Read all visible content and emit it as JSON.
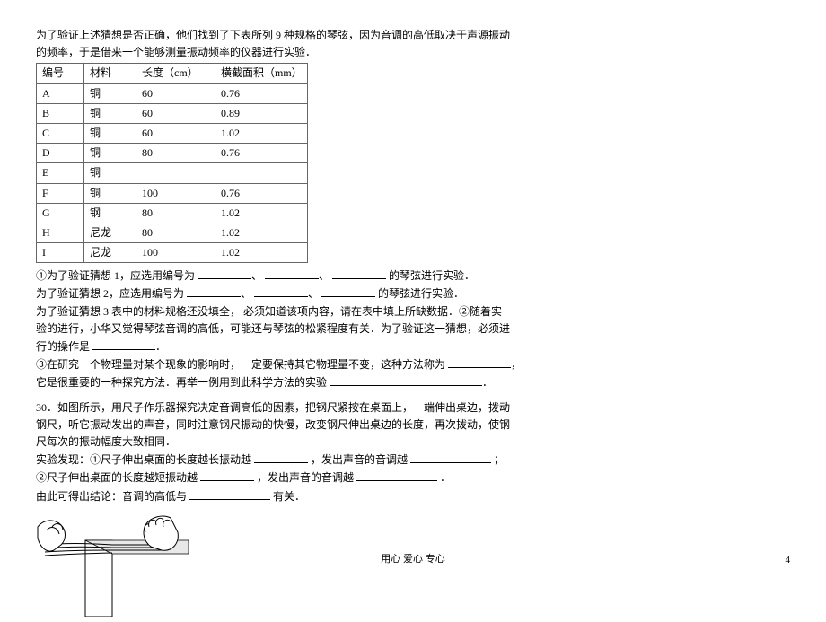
{
  "intro_line1": "为了验证上述猜想是否正确，他们找到了下表所列 9 种规格的琴弦，因为音调的高低取决于声源振动",
  "intro_line2": "的频率，于是借来一个能够测量振动频率的仪器进行实验．",
  "table": {
    "headers": [
      "编号",
      "材料",
      "长度（cm）",
      "横截面积（mm）"
    ],
    "rows": [
      [
        "A",
        "铜",
        "60",
        "0.76"
      ],
      [
        "B",
        "铜",
        "60",
        "0.89"
      ],
      [
        "C",
        "铜",
        "60",
        "1.02"
      ],
      [
        "D",
        "铜",
        "80",
        "0.76"
      ],
      [
        "E",
        "铜",
        "",
        ""
      ],
      [
        "F",
        "铜",
        "100",
        "0.76"
      ],
      [
        "G",
        "钢",
        "80",
        "1.02"
      ],
      [
        "H",
        "尼龙",
        "80",
        "1.02"
      ],
      [
        "I",
        "尼龙",
        "100",
        "1.02"
      ]
    ]
  },
  "q1_a": "①为了验证猜想 1，应选用编号为",
  "q1_b": "的琴弦进行实验．",
  "q2_a": "为了验证猜想 2，应选用编号为",
  "q2_b": "的琴弦进行实验．",
  "q3_a": "为了验证猜想 3  表中的材料规格还没填全，  必须知道该项内容，请在表中填上所缺数据．②随着实",
  "q3_b": "验的进行，小华又觉得琴弦音调的高低，可能还与琴弦的松紧程度有关．为了验证这一猜想，必须进",
  "q3_c": "行的操作是",
  "q4_a": "③在研究一个物理量对某个现象的影响时，一定要保持其它物理量不变，这种方法称为",
  "q4_b": "它是很重要的一种探究方法．再举一例用到此科学方法的实验",
  "q30_a": "30．如图所示，用尺子作乐器探究决定音调高低的因素，把钢尺紧按在桌面上，一端伸出桌边，拨动",
  "q30_b": "钢尺，听它振动发出的声音，同时注意钢尺振动的快慢，改变钢尺伸出桌边的长度，再次拨动，使钢",
  "q30_c": "尺每次的振动幅度大致相同．",
  "q30_d1": "实验发现：①尺子伸出桌面的长度越长振动越",
  "q30_d2": "，发出声音的音调越",
  "q30_d3": "；",
  "q30_e1": "②尺子伸出桌面的长度越短振动越",
  "q30_e2": "，发出声音的音调越",
  "q30_e3": "．",
  "q30_f1": "由此可得出结论：音调的高低与",
  "q30_f2": "有关．",
  "footer": "用心      爱心      专心",
  "pagenum": "4",
  "sep_comma": "、",
  "sep_comma2": "，",
  "period": "．"
}
